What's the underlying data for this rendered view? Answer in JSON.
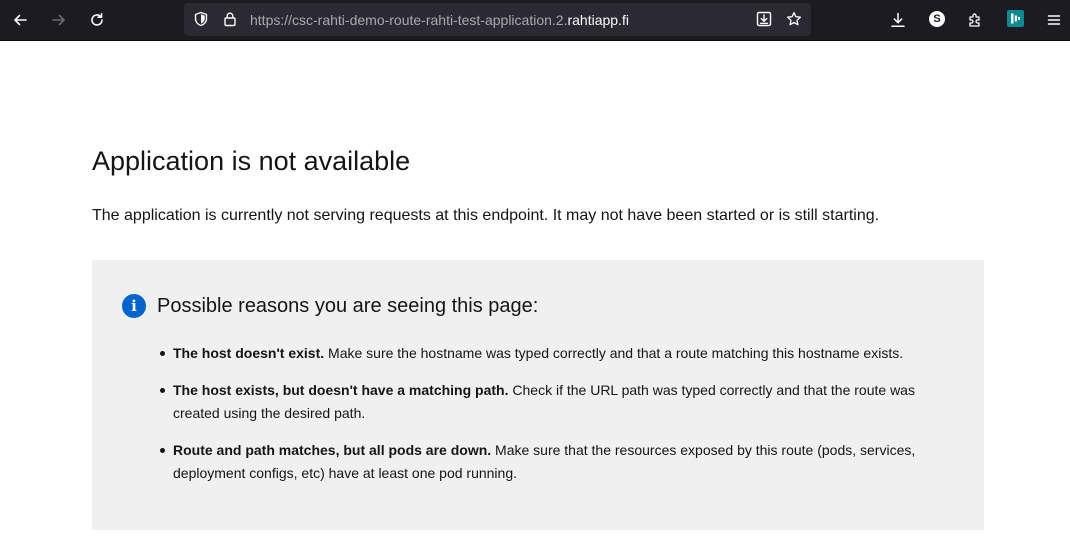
{
  "browser": {
    "url_prefix": "https://csc-rahti-demo-route-rahti-test-application.2.",
    "url_domain": "rahtiapp.fi",
    "extension_badge": "S",
    "icons": {
      "back": "arrow-left-icon",
      "forward": "arrow-right-icon",
      "reload": "reload-icon",
      "tracking": "shield-icon",
      "lock": "lock-icon",
      "page_download": "download-tray-icon",
      "bookmark": "star-icon",
      "downloads": "download-icon",
      "extensions": "puzzle-icon",
      "menu": "hamburger-icon"
    },
    "colors": {
      "toolbar_bg": "#1c1b22",
      "urlbar_bg": "#2b2a33",
      "icon": "#fbfbfe",
      "icon_disabled": "#6d6c72"
    }
  },
  "page": {
    "title": "Application is not available",
    "lead": "The application is currently not serving requests at this endpoint. It may not have been started or is still starting.",
    "reasons": {
      "heading": "Possible reasons you are seeing this page:",
      "items": [
        {
          "bold": "The host doesn't exist.",
          "text": " Make sure the hostname was typed correctly and that a route matching this hostname exists."
        },
        {
          "bold": "The host exists, but doesn't have a matching path.",
          "text": " Check if the URL path was typed correctly and that the route was created using the desired path."
        },
        {
          "bold": "Route and path matches, but all pods are down.",
          "text": " Make sure that the resources exposed by this route (pods, services, deployment configs, etc) have at least one pod running."
        }
      ]
    },
    "colors": {
      "box_bg": "#f0f0f0",
      "info_icon": "#0066cc",
      "text": "#151515"
    }
  }
}
